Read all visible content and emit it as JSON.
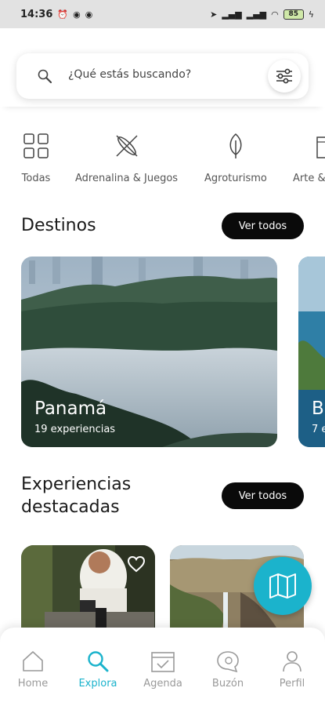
{
  "status_bar": {
    "time": "14:36",
    "battery": "85"
  },
  "search": {
    "placeholder": "¿Qué estás buscando?"
  },
  "categories": [
    {
      "label": "Todas",
      "icon": "grid-icon"
    },
    {
      "label": "Adrenalina & Juegos",
      "icon": "kayak-icon"
    },
    {
      "label": "Agroturismo",
      "icon": "leaf-icon"
    },
    {
      "label": "Arte & ",
      "icon": "building-icon"
    }
  ],
  "destinos": {
    "title": "Destinos",
    "button": "Ver todos",
    "cards": [
      {
        "name": "Panamá",
        "count": "19 experiencias"
      },
      {
        "name": "B",
        "count": "7 e"
      }
    ]
  },
  "destacadas": {
    "title_line1": "Experiencias",
    "title_line2": "destacadas",
    "button": "Ver todos"
  },
  "nav": [
    {
      "label": "Home",
      "icon": "home-icon"
    },
    {
      "label": "Explora",
      "icon": "search-icon"
    },
    {
      "label": "Agenda",
      "icon": "calendar-icon"
    },
    {
      "label": "Buzón",
      "icon": "chat-icon"
    },
    {
      "label": "Perfil",
      "icon": "user-icon"
    }
  ],
  "colors": {
    "accent": "#1bb3cc",
    "dark_pill": "#0a0a0a",
    "inactive": "#9a9a9a"
  }
}
